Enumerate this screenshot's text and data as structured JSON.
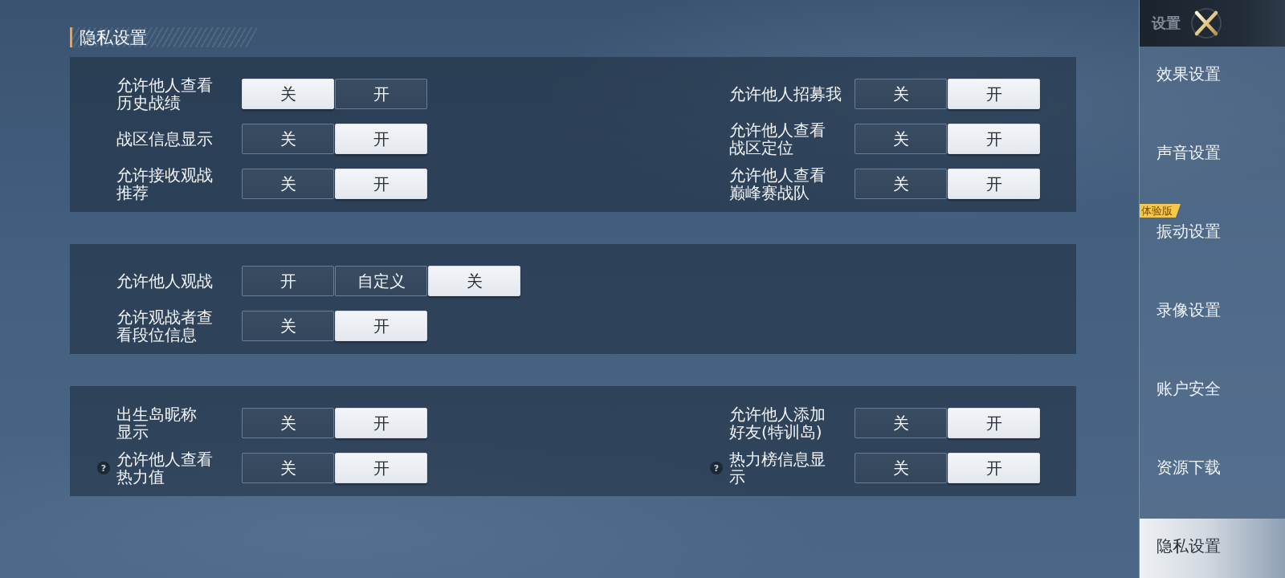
{
  "title": "隐私设置",
  "sections": [
    {
      "columns": [
        {
          "rows": [
            {
              "lines": [
                "允许他人查看",
                "历史战绩"
              ],
              "options": [
                {
                  "label": "关",
                  "selected": true
                },
                {
                  "label": "开",
                  "selected": false
                }
              ]
            },
            {
              "lines": [
                "战区信息显示"
              ],
              "options": [
                {
                  "label": "关",
                  "selected": false
                },
                {
                  "label": "开",
                  "selected": true
                }
              ]
            },
            {
              "lines": [
                "允许接收观战",
                "推荐"
              ],
              "options": [
                {
                  "label": "关",
                  "selected": false
                },
                {
                  "label": "开",
                  "selected": true
                }
              ]
            }
          ]
        },
        {
          "rows": [
            {
              "lines": [
                "允许他人招募我"
              ],
              "options": [
                {
                  "label": "关",
                  "selected": false
                },
                {
                  "label": "开",
                  "selected": true
                }
              ]
            },
            {
              "lines": [
                "允许他人查看",
                "战区定位"
              ],
              "options": [
                {
                  "label": "关",
                  "selected": false
                },
                {
                  "label": "开",
                  "selected": true
                }
              ]
            },
            {
              "lines": [
                "允许他人查看",
                "巅峰赛战队"
              ],
              "options": [
                {
                  "label": "关",
                  "selected": false
                },
                {
                  "label": "开",
                  "selected": true
                }
              ]
            }
          ]
        }
      ]
    },
    {
      "columns": [
        {
          "rows": [
            {
              "lines": [
                "允许他人观战"
              ],
              "options": [
                {
                  "label": "开",
                  "selected": false
                },
                {
                  "label": "自定义",
                  "selected": false
                },
                {
                  "label": "关",
                  "selected": true
                }
              ]
            },
            {
              "lines": [
                "允许观战者查",
                "看段位信息"
              ],
              "options": [
                {
                  "label": "关",
                  "selected": false
                },
                {
                  "label": "开",
                  "selected": true
                }
              ]
            }
          ]
        }
      ]
    },
    {
      "columns": [
        {
          "rows": [
            {
              "lines": [
                "出生岛昵称",
                "显示"
              ],
              "options": [
                {
                  "label": "关",
                  "selected": false
                },
                {
                  "label": "开",
                  "selected": true
                }
              ]
            },
            {
              "lines": [
                "允许他人查看",
                "热力值"
              ],
              "help": "?",
              "options": [
                {
                  "label": "关",
                  "selected": false
                },
                {
                  "label": "开",
                  "selected": true
                }
              ]
            }
          ]
        },
        {
          "rows": [
            {
              "lines": [
                "允许他人添加",
                "好友(特训岛)"
              ],
              "options": [
                {
                  "label": "关",
                  "selected": false
                },
                {
                  "label": "开",
                  "selected": true
                }
              ]
            },
            {
              "lines": [
                "热力榜信息显",
                "示"
              ],
              "help": "?",
              "options": [
                {
                  "label": "关",
                  "selected": false
                },
                {
                  "label": "开",
                  "selected": true
                }
              ]
            }
          ]
        }
      ]
    }
  ],
  "sidebar": {
    "title": "设置",
    "items": [
      {
        "label": "效果设置",
        "selected": false
      },
      {
        "label": "声音设置",
        "selected": false
      },
      {
        "label": "振动设置",
        "selected": false,
        "badge": "体验版"
      },
      {
        "label": "录像设置",
        "selected": false
      },
      {
        "label": "账户安全",
        "selected": false
      },
      {
        "label": "资源下载",
        "selected": false
      },
      {
        "label": "隐私设置",
        "selected": true
      }
    ]
  }
}
